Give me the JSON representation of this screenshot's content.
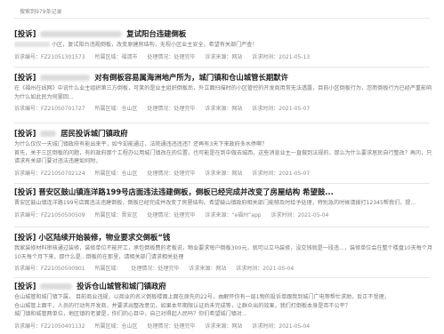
{
  "summary": "搜索到979条记录",
  "items": [
    {
      "tag": "[投诉]",
      "title_rest": "复试阳台违建倒板",
      "lines": [
        "小区，复试阳台违规倒板，改变原建房结构，无视小区业主安全，希望有关部门严查！"
      ],
      "meta": {
        "no": "诉求编号：FZ21051301573",
        "region": "所属区域：福清市",
        "status": "处理情况：处理完毕",
        "source": "诉求来源：网站",
        "date": "诉求时间：2021-05-13"
      }
    },
    {
      "tag": "[投诉]",
      "title_rest": "对有倒板容易属海洲地产所为，城门镇和仓山城管长期默许",
      "lines": [
        "在《福州在线网》中说什么业主组织第三方倒板，可笑的是业主组织倒板后，外立面扫描时的小区管控的开发商用常无法透露，目前小区倒板行为，忽而倒板行为已经严重影响了铁城及市场、违建者可以处理。该投诉地点城门镇以后组织投诉的...",
        "为什么如此民为何罢回..."
      ],
      "meta": {
        "no": "诉求编号：FZ21050701727",
        "region": "所属区域：仓山区",
        "status": "处理情况：处理完毕",
        "source": "诉求来源：网站",
        "date": "诉求时间：2021-05-07"
      }
    },
    {
      "tag": "[投诉]",
      "title_rest": "居民投诉城门镇政府",
      "lines": [
        "为什么仅仅一天城门镇政府有能出来平，如今却能通过，法院通违违违违？还再有3天下来政府多水停啊？",
        "首先，关于三区倒板的问题，有的政府那个工程办公用城门镇改在的位置，也可能是在到中做去城西，这些消息业主一直做到法规的，那么为什么要求居民自行整改？再问，只是居民整改的情况，部门在通报是什么？",
        "请求有关部门要对违法违建如何附，"
      ],
      "meta": {
        "no": "诉求编号：FZ21050702124",
        "region": "所属区域：仓山区",
        "status": "处理情况：处理完毕",
        "source": "诉求来源：网站",
        "date": "诉求时间：2021-05-07"
      }
    },
    {
      "tag": "[投诉]",
      "title_rest": "晋安区鼓山镇连洋路199号店面违法违建倒板，倒板已经完成并改变了房屋结构 希望鼓...",
      "lines": [
        "晋安区鼓山镇连洋路199号店面违法违建倒板，倒板已经完成并改变了房屋结构。希望鼓山镇政府相关部门能够及时给予处理，特别急的时候请拨打12345帮我们，提..."
      ],
      "meta": {
        "no": "诉求编号：FZ21050500509",
        "region": "所属区域：晋安区",
        "status": "处理情况：处理完毕",
        "source": "诉求来源：“e福州”app",
        "date": "诉求时间：2021-05-04"
      }
    },
    {
      "tag": "[投诉]",
      "title_rest": "小区陆续开始装修，物业要求交倒板“钱",
      "lines": [
        "我家装修材料审核通过装修，装修单位不能开工，承包倒板费的老板说，物业要求每户倒板300元，就可以立马装修，没交钱就是一段违...，装修单位会在整个楼盘10天每个月下来修整，那什么是...确实倒板费，请他说他刚办理停工办出的..",
        "10天每个月下来，那什么是...倒板的在那里，请相关部门请求相关处理"
      ],
      "meta": {
        "no": "诉求编号：FZ21050500901",
        "region": "所属区域：",
        "status": "处理情况：处理完毕",
        "source": "诉求来源：网站",
        "date": "诉求时间：2021-05-04"
      }
    },
    {
      "tag": "[投诉]",
      "title_rest": "投诉仓山城管和城门镇政府",
      "lines": [
        "仓山城管和城门镇下属，        目前商业违规，以商业的名义倒板楼面上面在原先的22号，由解怀你有一层1物的投诉单跟我到城门广电等帮忙求助，反正不受理，",
        "仓山城管上面干，人员的行动有开发商，并要求出整改意见，如果本年期限认证后未完成等，让群众出的效果，我们打倒板本身是否不公平？",
        "城门镇和城管两单位，地区镇的老婆是，你们的心目中，自己对得起人民吗？你们希望城门镇对..."
      ],
      "meta": {
        "no": "诉求编号：FZ21050401132",
        "region": "所属区域：仓山区",
        "status": "处理情况：处理完毕",
        "source": "诉求来源：网站",
        "date": "诉求时间：2021-05-04"
      }
    }
  ]
}
